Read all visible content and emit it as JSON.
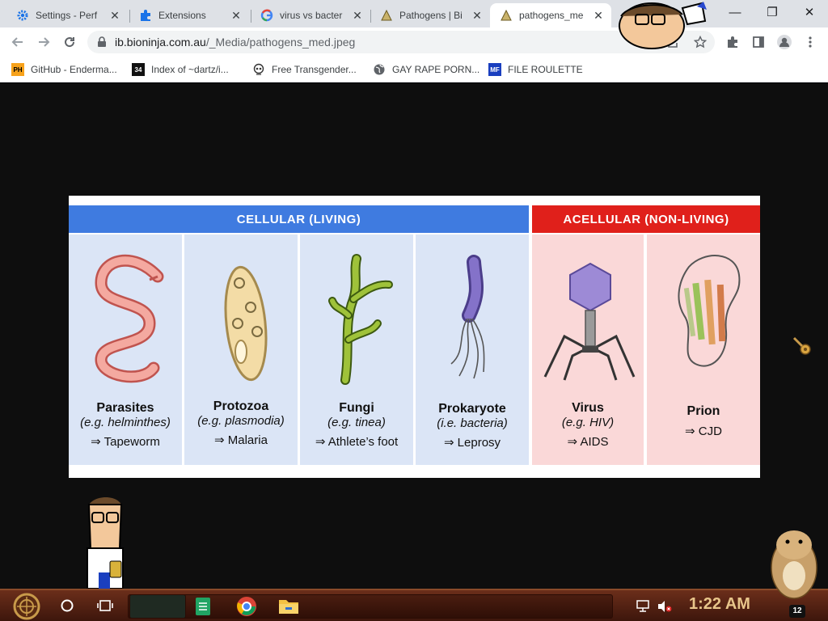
{
  "browser": {
    "tabs": [
      {
        "title": "Settings - Perf",
        "icon": "gear-icon",
        "active": false
      },
      {
        "title": "Extensions",
        "icon": "puzzle-icon",
        "active": false
      },
      {
        "title": "virus vs bacter",
        "icon": "google-icon",
        "active": false
      },
      {
        "title": "Pathogens | Bi",
        "icon": "bioninja-icon",
        "active": false
      },
      {
        "title": "pathogens_me",
        "icon": "bioninja-icon",
        "active": true
      }
    ],
    "close_glyph": "✕",
    "window_controls": {
      "minimize": "—",
      "maximize": "❐",
      "close": "✕"
    },
    "url": {
      "domain": "ib.bioninja.com.au",
      "path": "/_Media/pathogens_med.jpeg"
    },
    "bookmarks": [
      {
        "label": "GitHub - Enderma...",
        "icon": "ph-icon",
        "icon_text": "PH"
      },
      {
        "label": "Index of ~dartz/i...",
        "icon": "folder-34-icon",
        "icon_text": "34"
      },
      {
        "label": "Free Transgender...",
        "icon": "skull-icon",
        "icon_text": ""
      },
      {
        "label": "GAY RAPE PORN...",
        "icon": "globe-icon",
        "icon_text": ""
      },
      {
        "label": "FILE ROULETTE",
        "icon": "mft-icon",
        "icon_text": "MF"
      }
    ]
  },
  "figure": {
    "headers": {
      "cellular": "CELLULAR  (LIVING)",
      "acellular": "ACELLULAR  (NON-LIVING)"
    },
    "colors": {
      "cellular_header": "#3f7be0",
      "acellular_header": "#e0201b",
      "cellular_panel": "#dbe5f6",
      "acellular_panel": "#fad8d8"
    },
    "pathogens": [
      {
        "name": "Parasites",
        "example": "(e.g. helminthes)",
        "disease": "⇒ Tapeworm",
        "group": "cellular"
      },
      {
        "name": "Protozoa",
        "example": "(e.g. plasmodia)",
        "disease": "⇒ Malaria",
        "group": "cellular"
      },
      {
        "name": "Fungi",
        "example": "(e.g. tinea)",
        "disease": "⇒ Athlete’s foot",
        "group": "cellular"
      },
      {
        "name": "Prokaryote",
        "example": "(i.e. bacteria)",
        "disease": "⇒ Leprosy",
        "group": "cellular"
      },
      {
        "name": "Virus",
        "example": "(e.g. HIV)",
        "disease": "⇒ AIDS",
        "group": "acellular"
      },
      {
        "name": "Prion",
        "example": "",
        "disease": "⇒ CJD",
        "group": "acellular"
      }
    ]
  },
  "taskbar": {
    "clock": "1:22 AM",
    "notification_count": "12",
    "pinned": [
      "search-icon",
      "task-view-icon",
      "sheets-icon",
      "chrome-icon",
      "file-explorer-icon"
    ]
  }
}
